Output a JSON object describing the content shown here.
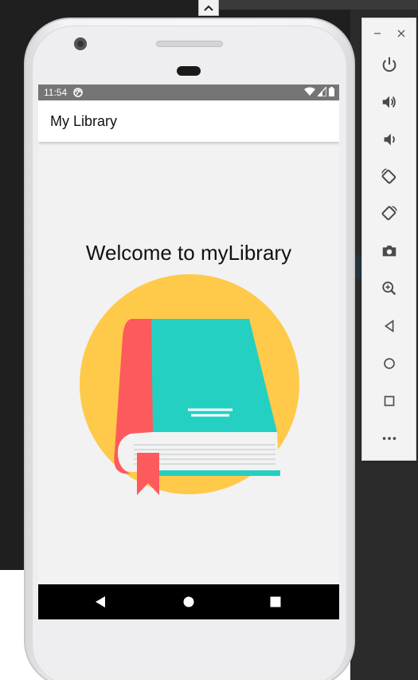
{
  "status_bar": {
    "time": "11:54"
  },
  "app_bar": {
    "title": "My Library"
  },
  "main": {
    "welcome_text": "Welcome to myLibrary"
  },
  "colors": {
    "circle": "#FFC94A",
    "book_cover": "#24D0C1",
    "spine": "#FD5A5E",
    "pages": "#F2F2F2",
    "status_bar": "#757575"
  },
  "nav_bar": {
    "buttons": [
      "back-icon",
      "home-icon",
      "recents-icon"
    ]
  },
  "side_panel": {
    "window_controls": [
      "minimize-icon",
      "close-icon"
    ],
    "buttons": [
      "power-icon",
      "volume-up-icon",
      "volume-down-icon",
      "rotate-left-icon",
      "rotate-right-icon",
      "camera-icon",
      "zoom-icon",
      "back-icon",
      "home-icon",
      "overview-icon",
      "more-icon"
    ]
  }
}
